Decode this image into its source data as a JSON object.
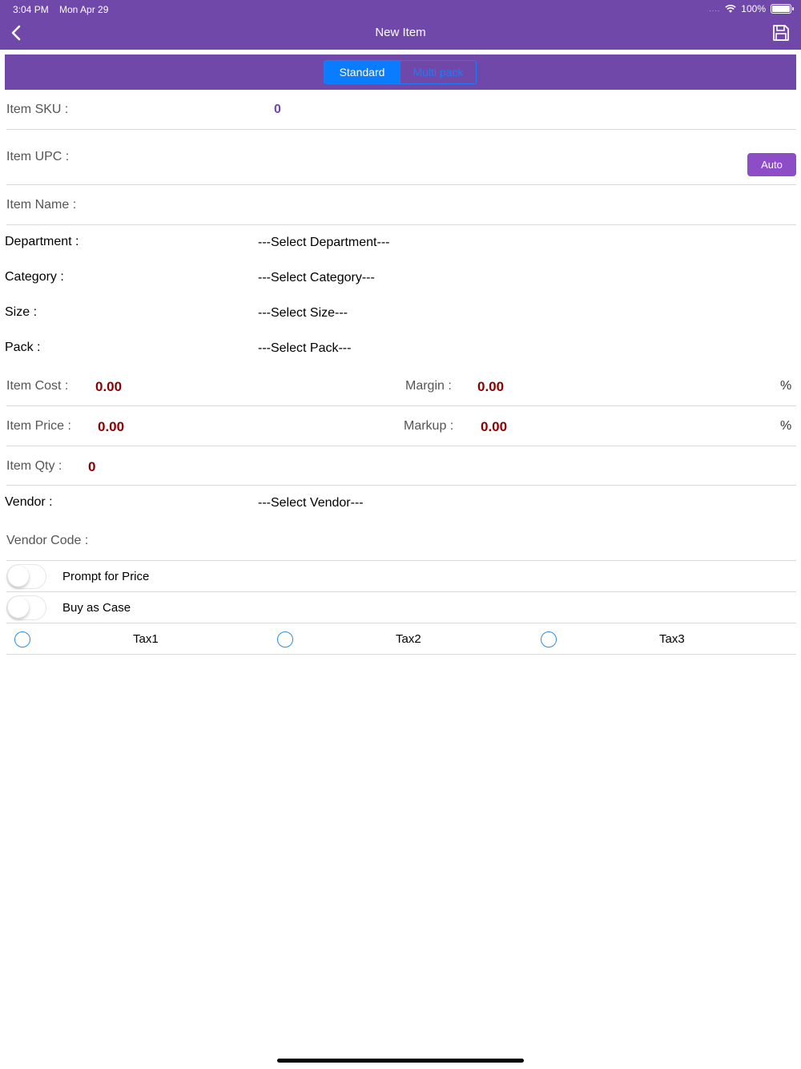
{
  "status": {
    "time": "3:04 PM",
    "date": "Mon Apr 29",
    "battery": "100%",
    "signal": "....",
    "wifi_icon": "wifi-icon",
    "battery_icon": "battery-icon"
  },
  "nav": {
    "title": "New Item",
    "back_icon": "chevron-left-icon",
    "save_icon": "save-icon"
  },
  "segment": {
    "options": [
      "Standard",
      "Multi pack"
    ],
    "selected": "Standard"
  },
  "form": {
    "sku": {
      "label": "Item SKU :",
      "value": "0"
    },
    "upc": {
      "label": "Item UPC :",
      "value": "",
      "auto_label": "Auto"
    },
    "name": {
      "label": "Item Name :",
      "value": ""
    },
    "department": {
      "label": "Department :",
      "value": "---Select Department---"
    },
    "category": {
      "label": "Category :",
      "value": "---Select Category---"
    },
    "size": {
      "label": "Size :",
      "value": "---Select Size---"
    },
    "pack": {
      "label": "Pack :",
      "value": "---Select Pack---"
    },
    "cost": {
      "label": "Item Cost :",
      "value": "0.00"
    },
    "margin": {
      "label": "Margin :",
      "value": "0.00",
      "unit": "%"
    },
    "price": {
      "label": "Item Price :",
      "value": "0.00"
    },
    "markup": {
      "label": "Markup :",
      "value": "0.00",
      "unit": "%"
    },
    "qty": {
      "label": "Item Qty :",
      "value": "0"
    },
    "vendor": {
      "label": "Vendor :",
      "value": "---Select Vendor---"
    },
    "vendor_code": {
      "label": "Vendor Code :",
      "value": ""
    },
    "prompt_for_price": {
      "label": "Prompt for Price",
      "on": false
    },
    "buy_as_case": {
      "label": "Buy as Case",
      "on": false
    },
    "taxes": [
      {
        "label": "Tax1",
        "selected": false
      },
      {
        "label": "Tax2",
        "selected": false
      },
      {
        "label": "Tax3",
        "selected": false
      }
    ]
  },
  "colors": {
    "brand": "#7048aa",
    "accent_blue": "#0a7cff",
    "value_red": "#8b0000",
    "auto_button": "#8c4dc7"
  }
}
